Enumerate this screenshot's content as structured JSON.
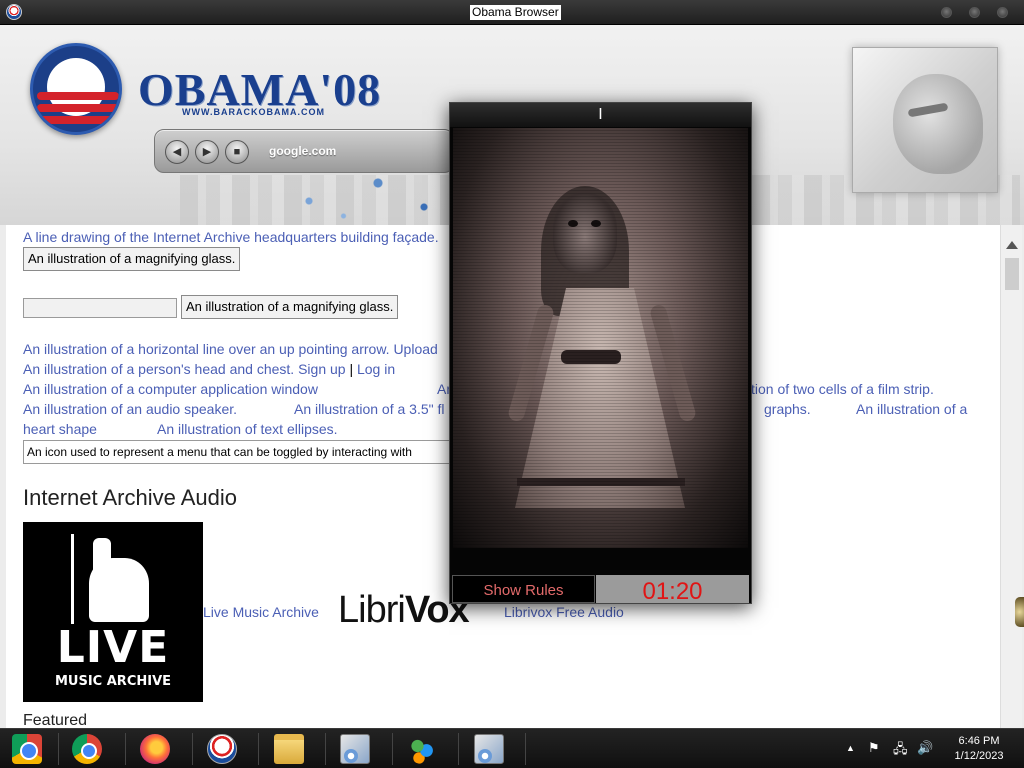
{
  "window": {
    "title": "Obama Browser"
  },
  "banner": {
    "brand": "OBAMA'08",
    "brand_url": "WWW.BARACKOBAMA.COM",
    "nav": {
      "back_label": "◀",
      "forward_label": "▶",
      "stop_label": "■",
      "url": "google.com"
    }
  },
  "archive": {
    "lines": {
      "building": "A line drawing of the Internet Archive headquarters building façade.",
      "mag_button_1": "An illustration of a magnifying glass.",
      "mag_button_2": "An illustration of a magnifying glass.",
      "upload": "An illustration of a horizontal line over an up pointing arrow. Upload",
      "person": "An illustration of a person's head and chest.",
      "sign_up": "Sign up",
      "pipe": "|",
      "log_in": "Log in",
      "computer": "An illustration of a computer application window",
      "row1_frag": "An",
      "film": "tion of two cells of a film strip.",
      "speaker": "An illustration of an audio speaker.",
      "floppy": "An illustration of a 3.5\" fl",
      "graphs": "graphs.",
      "heart_a": "An illustration of a",
      "heart_b": "heart shape",
      "ellipses": "An illustration of text ellipses.",
      "menu_toggle": "An icon used to represent a menu that can be toggled by interacting with"
    },
    "audio_heading": "Internet Archive Audio",
    "lma_tile": {
      "live": "LIVE",
      "sub": "MUSIC ARCHIVE"
    },
    "live_music_link": "Live Music Archive",
    "librivox_logo": {
      "a": "Libri",
      "b": "Vox"
    },
    "librivox_link": "Librivox Free Audio",
    "featured": "Featured"
  },
  "popup": {
    "title": "I",
    "rules_button": "Show Rules",
    "timer": "01:20"
  },
  "taskbar": {
    "items": [
      "start",
      "chrome",
      "firefox",
      "obama-browser",
      "file-explorer",
      "setup",
      "users",
      "setup-2"
    ],
    "tray": {
      "arrow": "▲",
      "flag": "⚑",
      "network": "🖧",
      "volume": "🔊"
    },
    "time": "6:46 PM",
    "date": "1/12/2023"
  }
}
